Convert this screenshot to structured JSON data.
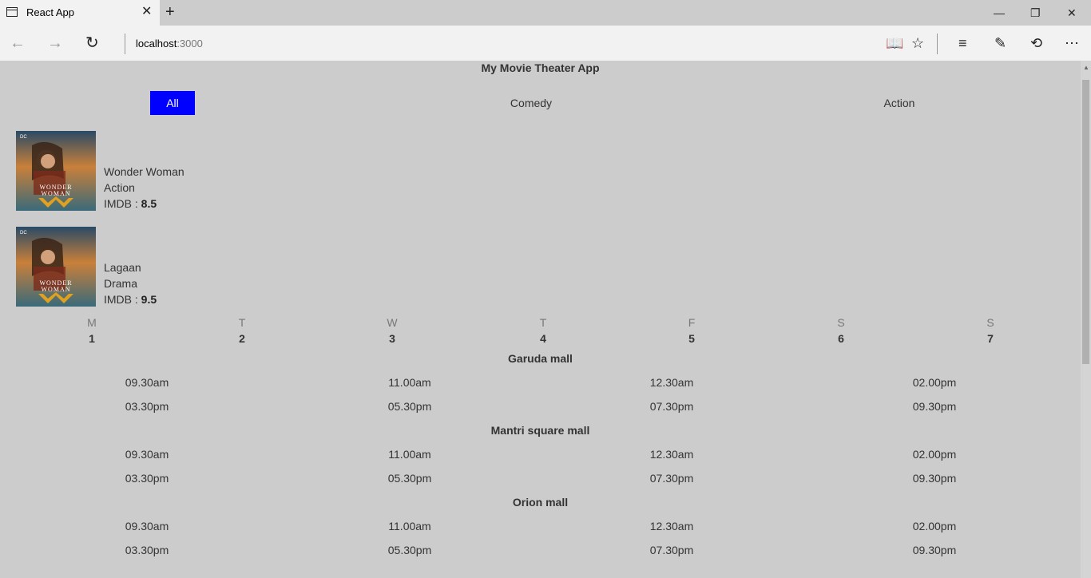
{
  "browser": {
    "tab_title": "React App",
    "url_host": "localhost",
    "url_port": ":3000"
  },
  "app": {
    "title": "My Movie Theater App",
    "filters": [
      "All",
      "Comedy",
      "Action"
    ],
    "active_filter": "All",
    "imdb_label": "IMDB : ",
    "movies": [
      {
        "name": "Wonder Woman",
        "genre": "Action",
        "rating": "8.5"
      },
      {
        "name": "Lagaan",
        "genre": "Drama",
        "rating": "9.5"
      }
    ],
    "days": [
      {
        "letter": "M",
        "num": "1"
      },
      {
        "letter": "T",
        "num": "2"
      },
      {
        "letter": "W",
        "num": "3"
      },
      {
        "letter": "T",
        "num": "4"
      },
      {
        "letter": "F",
        "num": "5"
      },
      {
        "letter": "S",
        "num": "6"
      },
      {
        "letter": "S",
        "num": "7"
      }
    ],
    "malls": [
      {
        "name": "Garuda mall",
        "times": [
          [
            "09.30am",
            "11.00am",
            "12.30am",
            "02.00pm"
          ],
          [
            "03.30pm",
            "05.30pm",
            "07.30pm",
            "09.30pm"
          ]
        ]
      },
      {
        "name": "Mantri square mall",
        "times": [
          [
            "09.30am",
            "11.00am",
            "12.30am",
            "02.00pm"
          ],
          [
            "03.30pm",
            "05.30pm",
            "07.30pm",
            "09.30pm"
          ]
        ]
      },
      {
        "name": "Orion mall",
        "times": [
          [
            "09.30am",
            "11.00am",
            "12.30am",
            "02.00pm"
          ],
          [
            "03.30pm",
            "05.30pm",
            "07.30pm",
            "09.30pm"
          ]
        ]
      }
    ]
  }
}
